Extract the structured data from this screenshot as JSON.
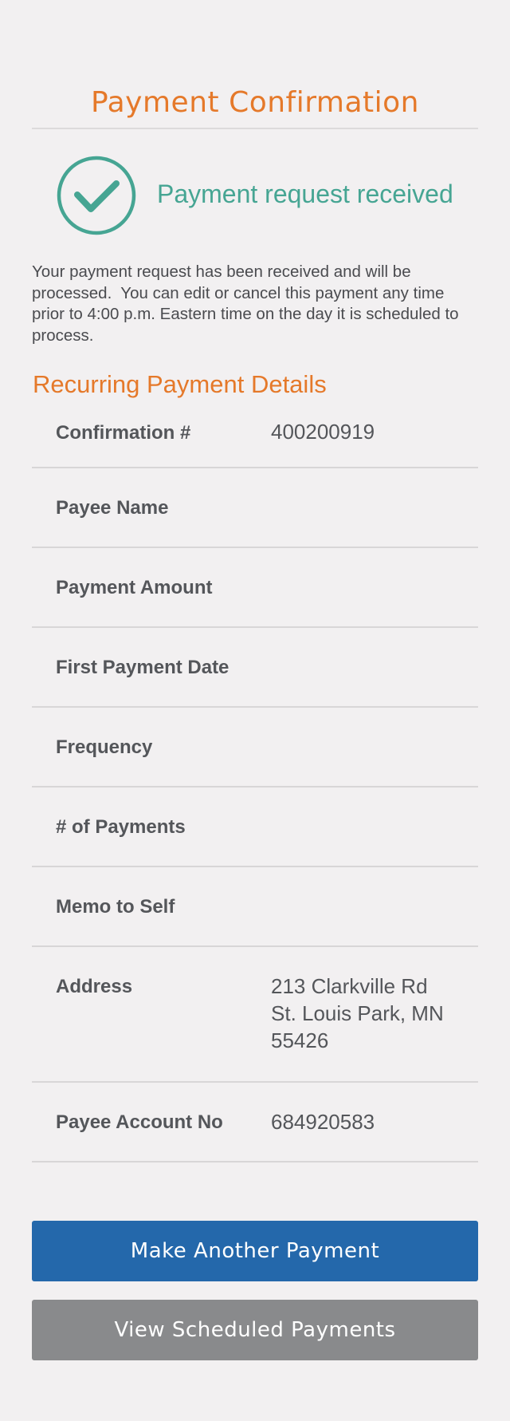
{
  "page": {
    "title": "Payment Confirmation"
  },
  "status": {
    "icon": "checkmark-circle-icon",
    "message": "Payment request received",
    "color": "#46a593"
  },
  "description": "Your payment request has been received and will be processed.  You can edit or cancel this payment any time prior to 4:00 p.m. Eastern time on the day it is scheduled to process.",
  "details": {
    "title": "Recurring Payment Details",
    "rows": [
      {
        "label": "Confirmation #",
        "value": "400200919"
      },
      {
        "label": "Payee Name",
        "value": ""
      },
      {
        "label": "Payment Amount",
        "value": ""
      },
      {
        "label": "First Payment Date",
        "value": ""
      },
      {
        "label": "Frequency",
        "value": ""
      },
      {
        "label": "# of Payments",
        "value": ""
      },
      {
        "label": "Memo to Self",
        "value": ""
      },
      {
        "label": "Address",
        "value": "213 Clarkville Rd\nSt. Louis Park, MN\n55426"
      },
      {
        "label": "Payee Account No",
        "value": "684920583"
      }
    ]
  },
  "actions": {
    "primary_label": "Make Another Payment",
    "secondary_label": "View Scheduled Payments"
  },
  "colors": {
    "accent": "#e5792a",
    "primary_button": "#2468ab",
    "secondary_button": "#898a8c",
    "background": "#f2f0f1"
  }
}
